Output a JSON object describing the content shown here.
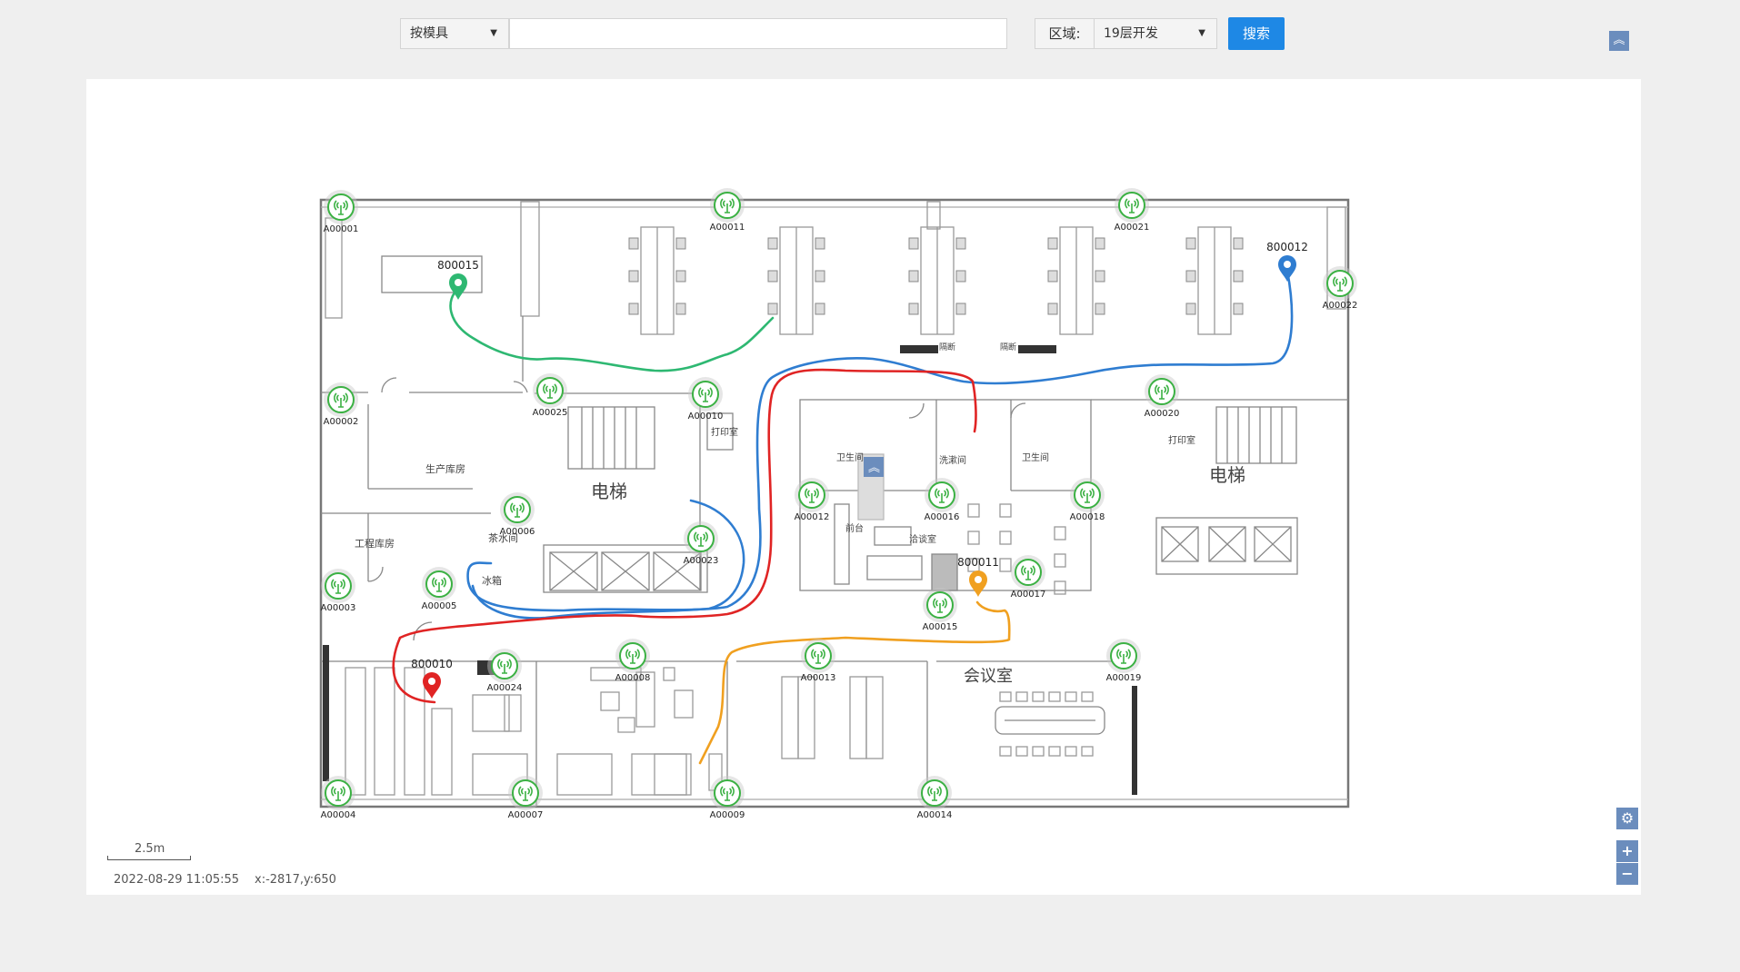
{
  "toolbar": {
    "mode_select": "按模具",
    "search_value": "",
    "area_label": "区域:",
    "area_select": "19层开发",
    "search_button": "搜索"
  },
  "map": {
    "rooms": {
      "prod_storage": "生产库房",
      "eng_storage": "工程库房",
      "tea_room": "茶水间",
      "fridge": "冰箱",
      "elevator_left": "电梯",
      "elevator_right": "电梯",
      "print_left": "打印室",
      "print_right": "打印室",
      "restroom_left": "卫生间",
      "restroom_right": "卫生间",
      "wash_room": "洗漱间",
      "front_desk": "前台",
      "meeting_small": "洽谈室",
      "meeting_room": "会议室",
      "partition_1": "隔断",
      "partition_2": "隔断"
    },
    "anchors": [
      {
        "id": "A00001"
      },
      {
        "id": "A00002"
      },
      {
        "id": "A00003"
      },
      {
        "id": "A00004"
      },
      {
        "id": "A00005"
      },
      {
        "id": "A00006"
      },
      {
        "id": "A00007"
      },
      {
        "id": "A00008"
      },
      {
        "id": "A00009"
      },
      {
        "id": "A00010"
      },
      {
        "id": "A00011"
      },
      {
        "id": "A00012"
      },
      {
        "id": "A00013"
      },
      {
        "id": "A00014"
      },
      {
        "id": "A00015"
      },
      {
        "id": "A00016"
      },
      {
        "id": "A00017"
      },
      {
        "id": "A00018"
      },
      {
        "id": "A00019"
      },
      {
        "id": "A00020"
      },
      {
        "id": "A00021"
      },
      {
        "id": "A00022"
      },
      {
        "id": "A00023"
      },
      {
        "id": "A00024"
      },
      {
        "id": "A00025"
      }
    ],
    "tags": [
      {
        "id": "800015",
        "color": "#2eb872"
      },
      {
        "id": "800012",
        "color": "#2f7dd1"
      },
      {
        "id": "800011",
        "color": "#f0a020"
      },
      {
        "id": "800010",
        "color": "#e02424"
      }
    ],
    "scale_label": "2.5m",
    "timestamp": "2022-08-29 11:05:55",
    "cursor_coord": "x:-2817,y:650"
  },
  "colors": {
    "accent": "#1e88e5",
    "anchor_green": "#3bb143",
    "track_green": "#2eb872",
    "track_blue": "#2f7dd1",
    "track_orange": "#f0a020",
    "track_red": "#e02424"
  }
}
